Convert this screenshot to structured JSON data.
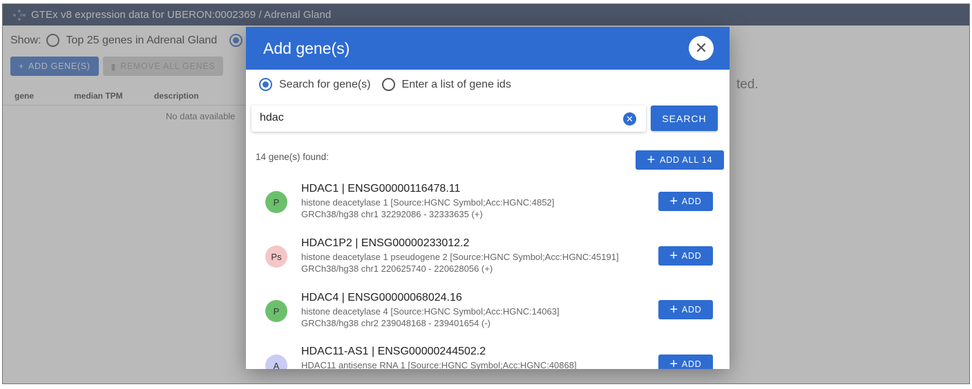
{
  "app": {
    "title": "GTEx v8 expression data for UBERON:0002369 / Adrenal Gland"
  },
  "background": {
    "show_label": "Show:",
    "show_option_1": "Top 25 genes in Adrenal Gland",
    "add_genes_label": "ADD GENE(S)",
    "remove_all_label": "REMOVE ALL GENES",
    "table_headers": [
      "gene",
      "median TPM",
      "description"
    ],
    "no_data": "No data available",
    "right_text": "ted."
  },
  "dialog": {
    "title": "Add gene(s)",
    "close_icon": "close-icon",
    "mode_options": [
      "Search for gene(s)",
      "Enter a list of gene ids"
    ],
    "search_value": "hdac",
    "search_button": "SEARCH",
    "found_text": "14 gene(s) found:",
    "add_all_label": "ADD ALL 14",
    "add_label": "ADD",
    "genes": [
      {
        "badge": "P",
        "badge_color": "#6cc06c",
        "name": "HDAC1 | ENSG00000116478.11",
        "description": "histone deacetylase 1 [Source:HGNC Symbol;Acc:HGNC:4852]",
        "location": "GRCh38/hg38 chr1 32292086 - 32333635 (+)"
      },
      {
        "badge": "Ps",
        "badge_color": "#f4c6c6",
        "name": "HDAC1P2 | ENSG00000233012.2",
        "description": "histone deacetylase 1 pseudogene 2 [Source:HGNC Symbol;Acc:HGNC:45191]",
        "location": "GRCh38/hg38 chr1 220625740 - 220628056 (+)"
      },
      {
        "badge": "P",
        "badge_color": "#6cc06c",
        "name": "HDAC4 | ENSG00000068024.16",
        "description": "histone deacetylase 4 [Source:HGNC Symbol;Acc:HGNC:14063]",
        "location": "GRCh38/hg38 chr2 239048168 - 239401654 (-)"
      },
      {
        "badge": "A",
        "badge_color": "#c9cdf3",
        "name": "HDAC11-AS1 | ENSG00000244502.2",
        "description": "HDAC11 antisense RNA 1 [Source:HGNC Symbol;Acc:HGNC:40868]",
        "location": ""
      }
    ]
  }
}
